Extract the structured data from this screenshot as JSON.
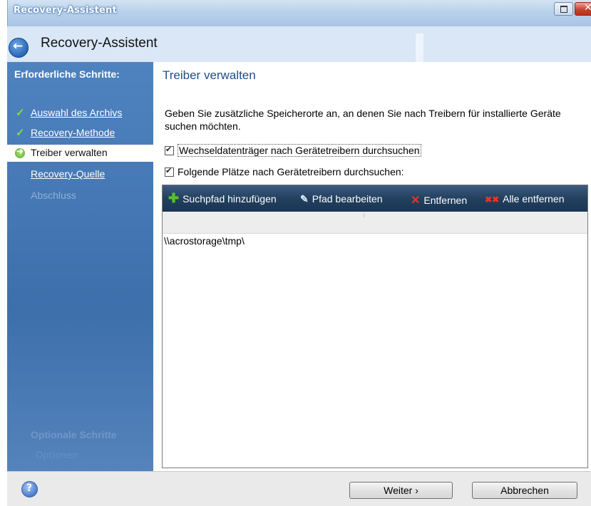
{
  "window": {
    "title": "Recovery-Assistent"
  },
  "header": {
    "title": "Recovery-Assistent"
  },
  "sidebar": {
    "required_heading": "Erforderliche Schritte:",
    "steps": [
      {
        "label": "Auswahl des Archivs",
        "state": "done"
      },
      {
        "label": "Recovery-Methode",
        "state": "done"
      },
      {
        "label": "Treiber verwalten",
        "state": "active"
      },
      {
        "label": "Recovery-Quelle",
        "state": "pending"
      },
      {
        "label": "Abschluss",
        "state": "disabled"
      }
    ],
    "optional_heading": "Optionale Schritte",
    "optional_item": "Optionen"
  },
  "main": {
    "title": "Treiber verwalten",
    "description": "Geben Sie zusätzliche Speicherorte an, an denen Sie nach Treibern für installierte Geräte suchen möchten.",
    "checkbox_removable": {
      "label": "Wechseldatenträger nach Gerätetreibern durchsuchen",
      "checked": true
    },
    "checkbox_locations": {
      "label": "Folgende Plätze nach Gerätetreibern durchsuchen:",
      "checked": true
    },
    "toolbar": {
      "add": "Suchpfad hinzufügen",
      "edit": "Pfad bearbeiten",
      "remove": "Entfernen",
      "remove_all": "Alle entfernen"
    },
    "paths": [
      "\\\\acrostorage\\tmp\\"
    ]
  },
  "footer": {
    "next": "Weiter",
    "cancel": "Abbrechen"
  }
}
